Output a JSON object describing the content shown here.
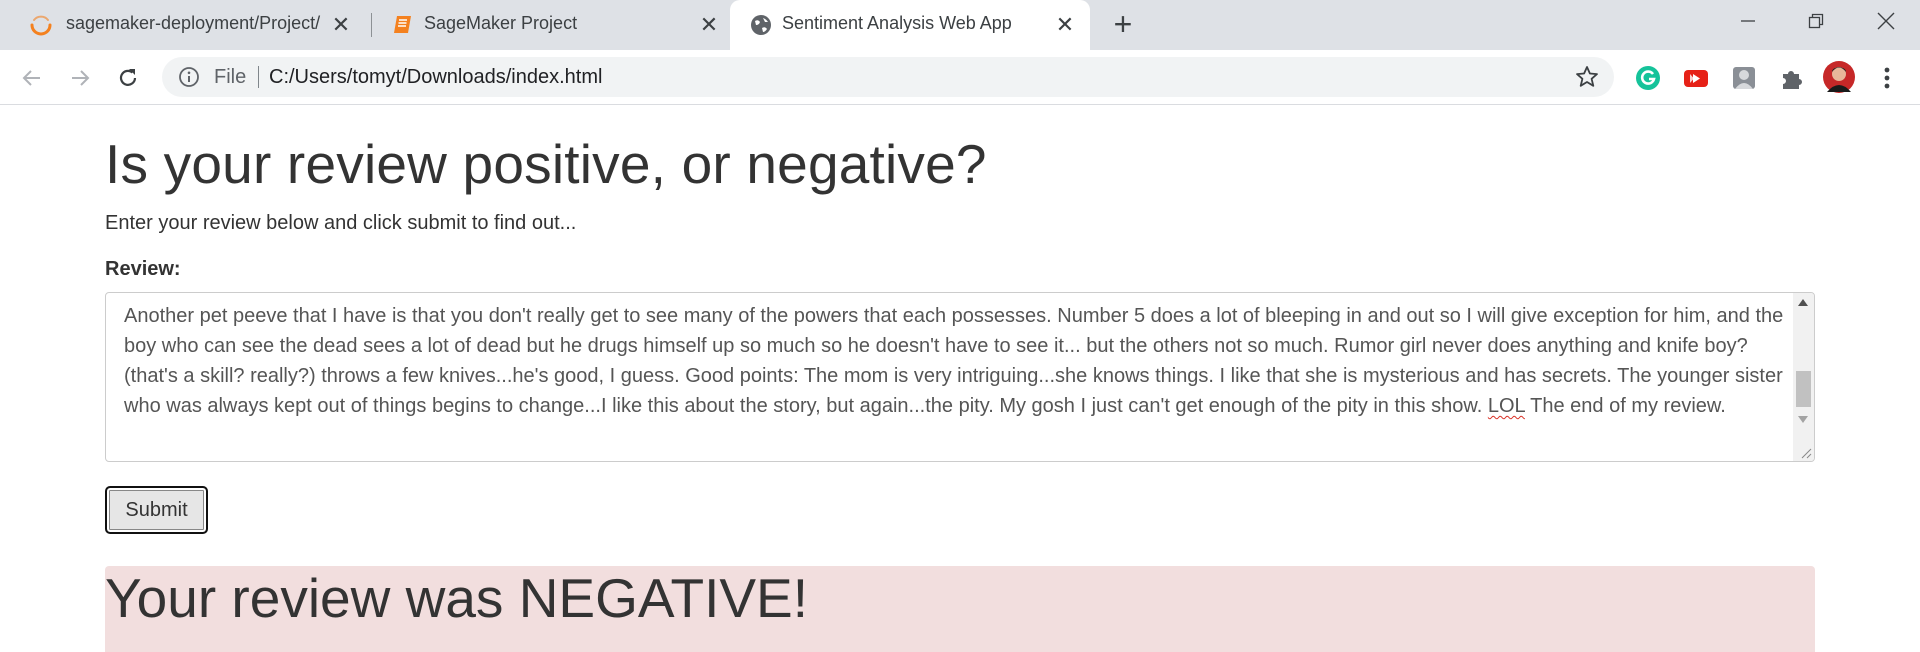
{
  "browser": {
    "tabs": [
      {
        "title": "sagemaker-deployment/Project/",
        "icon": "loading-spinner-icon"
      },
      {
        "title": "SageMaker Project",
        "icon": "notebook-icon"
      },
      {
        "title": "Sentiment Analysis Web App",
        "icon": "globe-icon",
        "active": true
      }
    ],
    "address": {
      "scheme_label": "File",
      "url": "C:/Users/tomyt/Downloads/index.html"
    },
    "extensions": [
      "grammarly-icon",
      "youtube-icon",
      "profile-photo-icon",
      "extensions-puzzle-icon",
      "avatar"
    ]
  },
  "page": {
    "heading": "Is your review positive, or negative?",
    "subtext": "Enter your review below and click submit to find out...",
    "review_label": "Review:",
    "review_text_before": "Another pet peeve that I have is that you don't really get to see many of the powers that each possesses. Number 5 does a lot of bleeping in and out so I will give exception for him, and the boy who can see the dead sees a lot of dead but he drugs himself up so much so he doesn't have to see it... but the others not so much. Rumor girl never does anything and knife boy?(that's a skill? really?) throws a few knives...he's good, I guess. Good points: The mom is very intriguing...she knows things. I like that she is mysterious and has secrets. The younger sister who was always kept out of things begins to change...I like this about the story, but again...the pity. My gosh I just can't get enough of the pity in this show. ",
    "review_text_misspelled": "LOL",
    "review_text_after": " The end of my review.",
    "submit_label": "Submit",
    "result": "Your review was NEGATIVE!"
  },
  "colors": {
    "tabstrip": "#dee1e6",
    "result_background": "#f2dede",
    "accent_orange": "#f4811f"
  }
}
